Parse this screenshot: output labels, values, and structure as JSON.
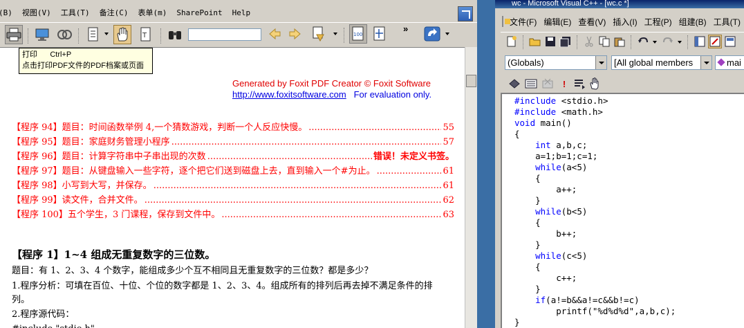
{
  "foxit": {
    "menu": [
      "(B)",
      "视图(V)",
      "工具(T)",
      "备注(C)",
      "表单(m)",
      "SharePoint",
      "Help"
    ],
    "toolbar": {
      "print": "print-icon",
      "screen": "monitor-icon",
      "hand": "hand-icon",
      "binoculars": "binoculars-icon",
      "find_value": "",
      "more": "»"
    },
    "tooltip": {
      "title": "打印",
      "shortcut": "Ctrl+P",
      "desc": "点击打印PDF文件的PDF档案或页面"
    },
    "banner": {
      "line1": "Generated by Foxit PDF Creator © Foxit Software",
      "url": "http://www.foxitsoftware.com",
      "note": "For evaluation only."
    },
    "toc": [
      {
        "text": "【程序 94】题目：时间函数举例 4,一个猜数游戏，判断一个人反应快慢。",
        "page": "55"
      },
      {
        "text": "【程序 95】题目：家庭财务管理小程序",
        "page": "57"
      },
      {
        "text": "【程序 96】题目：计算字符串中子串出现的次数",
        "page": "错误！未定义书签。"
      },
      {
        "text": "【程序 97】题目：从键盘输入一些字符，逐个把它们送到磁盘上去，直到输入一个#为止。",
        "page": "61"
      },
      {
        "text": "【程序 98】小写到大写，并保存。",
        "page": "61"
      },
      {
        "text": "【程序 99】读文件，合并文件。",
        "page": "62"
      },
      {
        "text": "【程序 100】五个学生，3 门课程，保存到文件中。",
        "page": "63"
      }
    ],
    "section_title": "【程序 1】1~4 组成无重复数字的三位数。",
    "body": [
      "题目：有 1、2、3、4 个数字，能组成多少个互不相同且无重复数字的三位数？都是多少？",
      "1.程序分析：可填在百位、十位、个位的数字都是 1、2、3、4。组成所有的排列后再去掉不满足条件的排",
      "列。",
      "2.程序源代码：",
      "#include \"stdio.h\""
    ]
  },
  "vc": {
    "title": "wc - Microsoft Visual C++ - [wc.c *]",
    "menu": [
      "文件(F)",
      "编辑(E)",
      "查看(V)",
      "插入(I)",
      "工程(P)",
      "组建(B)",
      "工具(T)"
    ],
    "combo_scope": "(Globals)",
    "combo_members": "[All global members",
    "combo_func": "mai",
    "code": [
      "#include <stdio.h>",
      "#include <math.h>",
      "void main()",
      "{",
      "    int a,b,c;",
      "    a=1;b=1;c=1;",
      "    while(a<5)",
      "    {",
      "        a++;",
      "    }",
      "    while(b<5)",
      "    {",
      "        b++;",
      "    }",
      "    while(c<5)",
      "    {",
      "        c++;",
      "    }",
      "    if(a!=b&&a!=c&&b!=c)",
      "        printf(\"%d%d%d\",a,b,c);",
      "}"
    ]
  },
  "colors": {
    "toc_red": "#ff0000",
    "banner_red": "#e00000",
    "banner_blue": "#0000e0",
    "keyword_blue": "#0000ff",
    "desktop_blue": "#3a6ea5"
  }
}
